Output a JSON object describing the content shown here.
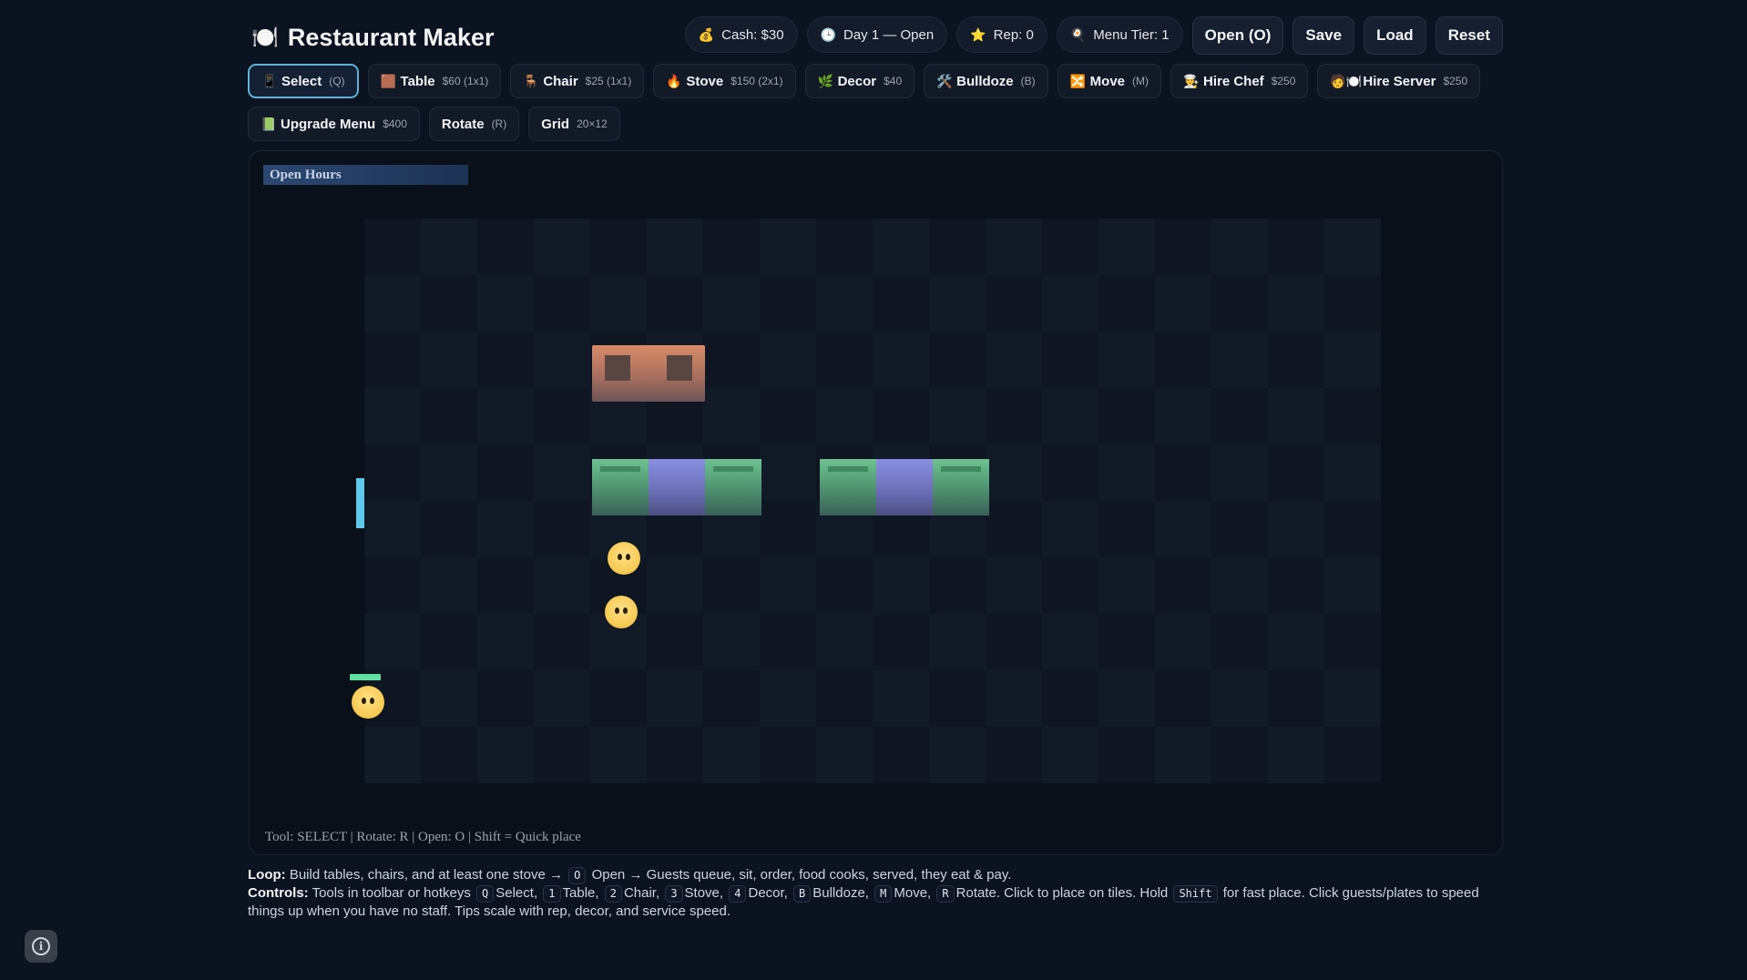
{
  "app": {
    "title": "Restaurant Maker",
    "logo_icon": "🍽️"
  },
  "stats": {
    "cash": {
      "icon": "💰",
      "label": "Cash: $30"
    },
    "day": {
      "icon": "🕒",
      "label": "Day 1 — Open"
    },
    "rep": {
      "icon": "⭐",
      "label": "Rep: 0"
    },
    "menu": {
      "icon": "🍳",
      "label": "Menu Tier: 1"
    }
  },
  "actions": {
    "open": "Open (O)",
    "save": "Save",
    "load": "Load",
    "reset": "Reset"
  },
  "tools": [
    {
      "id": "select",
      "icon": "📱",
      "label": "Select",
      "sub": "(Q)",
      "active": true
    },
    {
      "id": "table",
      "icon": "🟫",
      "label": "Table",
      "sub": "$60 (1x1)"
    },
    {
      "id": "chair",
      "icon": "🪑",
      "label": "Chair",
      "sub": "$25 (1x1)"
    },
    {
      "id": "stove",
      "icon": "🔥",
      "label": "Stove",
      "sub": "$150 (2x1)"
    },
    {
      "id": "decor",
      "icon": "🌿",
      "label": "Decor",
      "sub": "$40"
    },
    {
      "id": "bulldoze",
      "icon": "🛠️",
      "label": "Bulldoze",
      "sub": "(B)"
    },
    {
      "id": "move",
      "icon": "🔀",
      "label": "Move",
      "sub": "(M)"
    },
    {
      "id": "hire-chef",
      "icon": "👨‍🍳",
      "label": "Hire Chef",
      "sub": "$250"
    },
    {
      "id": "hire-server",
      "icon": "🧑🍽️",
      "label": "Hire Server",
      "sub": "$250"
    },
    {
      "id": "upgrade-menu",
      "icon": "📗",
      "label": "Upgrade Menu",
      "sub": "$400"
    },
    {
      "id": "rotate",
      "icon": "",
      "label": "Rotate",
      "sub": "(R)"
    },
    {
      "id": "grid",
      "icon": "",
      "label": "Grid",
      "sub": "20×12"
    }
  ],
  "board": {
    "banner": "Open Hours",
    "status": "Tool: SELECT  |  Rotate: R  |  Open: O  |  Shift = Quick place",
    "grid": {
      "cols": 18,
      "rows": 10
    }
  },
  "help": {
    "loop_label": "Loop:",
    "loop_text_1": "Build tables, chairs, and at least one stove →",
    "loop_key": "O",
    "loop_text_2": "Open → Guests queue, sit, order, food cooks, served, they eat & pay.",
    "controls_label": "Controls:",
    "controls_text": "Tools in toolbar or hotkeys",
    "hotkeys": [
      {
        "key": "Q",
        "label": "Select,"
      },
      {
        "key": "1",
        "label": "Table,"
      },
      {
        "key": "2",
        "label": "Chair,"
      },
      {
        "key": "3",
        "label": "Stove,"
      },
      {
        "key": "4",
        "label": "Decor,"
      },
      {
        "key": "B",
        "label": "Bulldoze,"
      },
      {
        "key": "M",
        "label": "Move,"
      },
      {
        "key": "R",
        "label": "Rotate. Click to place on tiles. Hold"
      }
    ],
    "shift_key": "Shift",
    "controls_tail": "for fast place. Click guests/plates to speed things up when you have no staff. Tips scale with rep, decor, and service speed."
  },
  "info_icon": "i"
}
